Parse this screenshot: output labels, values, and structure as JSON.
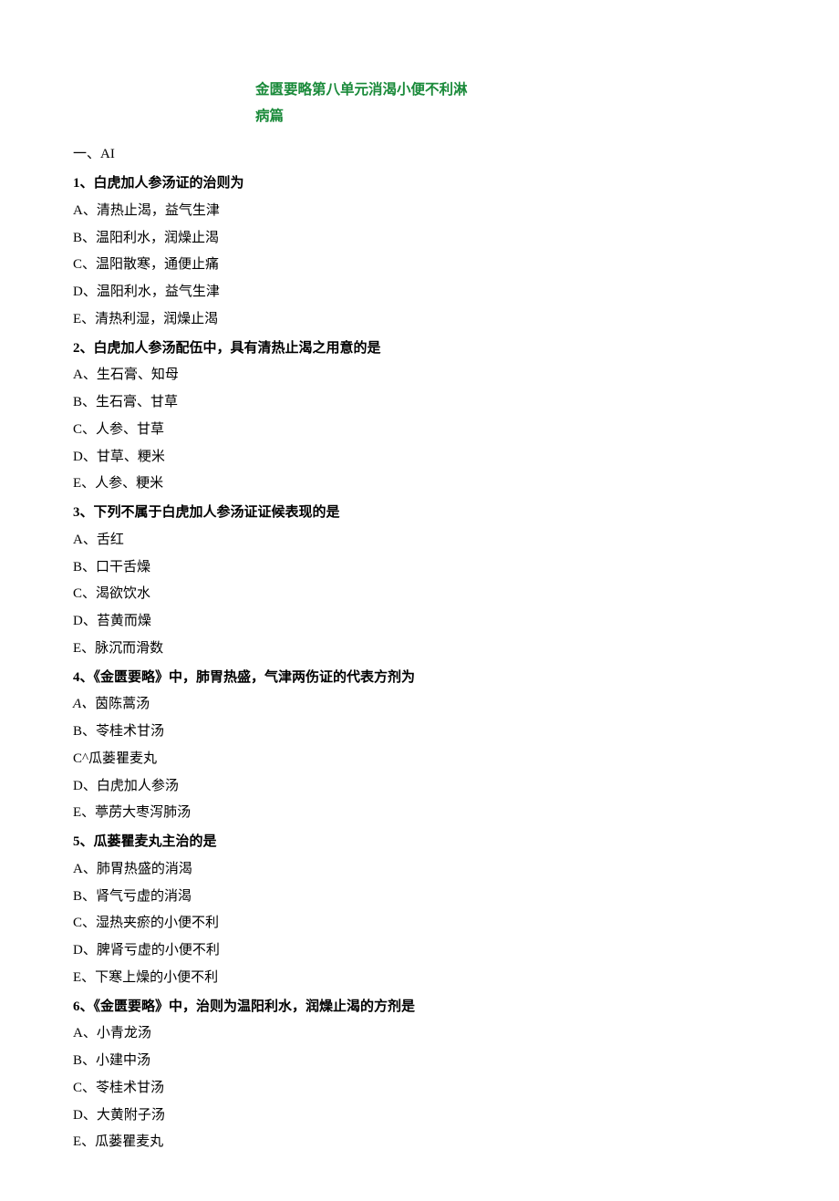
{
  "title": {
    "line1": "金匮要略第八单元消渴小便不利淋",
    "line2": "病篇"
  },
  "section_label": "一、AI",
  "questions": [
    {
      "stem": "1、白虎加人参汤证的治则为",
      "options": [
        {
          "marker": "A、",
          "text": "清热止渴，益气生津"
        },
        {
          "marker": "B、",
          "text": "温阳利水，润燥止渴"
        },
        {
          "marker": "C、",
          "text": "温阳散寒，通便止痛"
        },
        {
          "marker": "D、",
          "text": "温阳利水，益气生津"
        },
        {
          "marker": "E、",
          "text": "清热利湿，润燥止渴"
        }
      ]
    },
    {
      "stem": "2、白虎加人参汤配伍中，具有清热止渴之用意的是",
      "options": [
        {
          "marker": "A、",
          "text": "生石膏、知母"
        },
        {
          "marker": "B、",
          "text": "生石膏、甘草"
        },
        {
          "marker": "C、",
          "text": "人参、甘草"
        },
        {
          "marker": "D、",
          "text": "甘草、粳米"
        },
        {
          "marker": "E、",
          "text": "人参、粳米"
        }
      ]
    },
    {
      "stem": "3、下列不属于白虎加人参汤证证候表现的是",
      "options": [
        {
          "marker": "A、",
          "text": "舌红"
        },
        {
          "marker": "B、",
          "text": "口干舌燥"
        },
        {
          "marker": "C、",
          "text": "渴欲饮水"
        },
        {
          "marker": "D、",
          "text": "苔黄而燥"
        },
        {
          "marker": "E、",
          "text": "脉沉而滑数"
        }
      ]
    },
    {
      "stem": "4、《金匮要略》中，肺胃热盛，气津两伤证的代表方剂为",
      "options": [
        {
          "marker": "A、",
          "text": "茵陈蒿汤",
          "marker_italic": true
        },
        {
          "marker": "B、",
          "text": "苓桂术甘汤"
        },
        {
          "marker": "C^",
          "text": "瓜蒌瞿麦丸"
        },
        {
          "marker": "D、",
          "text": "白虎加人参汤"
        },
        {
          "marker": "E、",
          "text": "葶苈大枣泻肺汤"
        }
      ]
    },
    {
      "stem": "5、瓜蒌瞿麦丸主治的是",
      "options": [
        {
          "marker": "A、",
          "text": "肺胃热盛的消渴"
        },
        {
          "marker": "B、",
          "text": "肾气亏虚的消渴"
        },
        {
          "marker": "C、",
          "text": "湿热夹瘀的小便不利"
        },
        {
          "marker": "D、",
          "text": "脾肾亏虚的小便不利"
        },
        {
          "marker": "E、",
          "text": "下寒上燥的小便不利"
        }
      ]
    },
    {
      "stem": "6、《金匮要略》中，治则为温阳利水，润燥止渴的方剂是",
      "options": [
        {
          "marker": "A、",
          "text": "小青龙汤"
        },
        {
          "marker": "B、",
          "text": "小建中汤"
        },
        {
          "marker": "C、",
          "text": "苓桂术甘汤"
        },
        {
          "marker": "D、",
          "text": "大黄附子汤"
        },
        {
          "marker": "E、",
          "text": "瓜蒌瞿麦丸"
        }
      ]
    }
  ]
}
